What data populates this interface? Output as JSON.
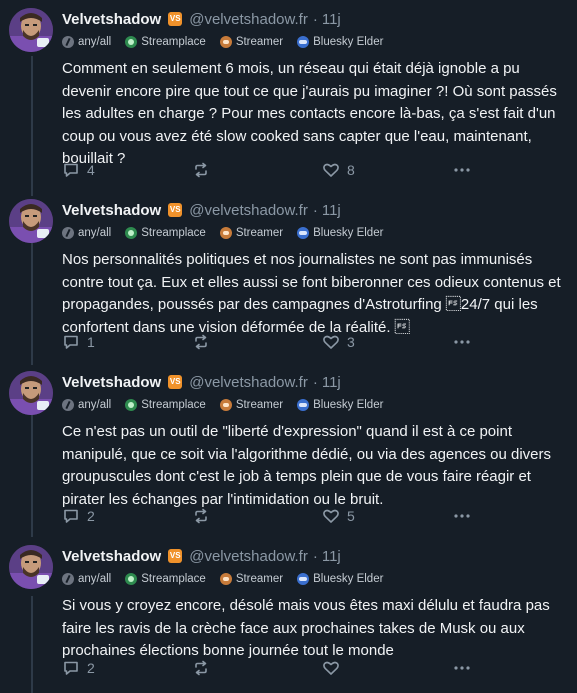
{
  "author": {
    "name": "Velvetshadow",
    "badge_label": "VS",
    "handle": "@velvetshadow.fr",
    "separator": "·",
    "time": "11j"
  },
  "badges": [
    {
      "icon": "any-icon",
      "label": "any/all"
    },
    {
      "icon": "streamplace-icon",
      "label": "Streamplace"
    },
    {
      "icon": "streamer-icon",
      "label": "Streamer"
    },
    {
      "icon": "bluesky-elder-icon",
      "label": "Bluesky Elder"
    }
  ],
  "posts": [
    {
      "text": "Comment en seulement 6 mois, un réseau qui était déjà ignoble a pu devenir encore pire que tout ce que j'aurais pu imaginer ?! Où sont passés les adultes en charge ? Pour mes contacts encore là-bas, ça s'est fait d'un coup ou vous avez été slow cooked sans capter que l'eau, maintenant, bouillait ?",
      "replies": "4",
      "reposts": "",
      "likes": "8"
    },
    {
      "text": "Nos personnalités politiques et nos journalistes ne sont pas immunisés contre tout ça. Eux et elles aussi se font biberonner ces odieux contenus et propagandes, poussés par des campagnes d'Astroturfing \u001c24/7 qui les confortent dans une vision déformée de la réalité. \u001c",
      "replies": "1",
      "reposts": "",
      "likes": "3"
    },
    {
      "text": "Ce n'est pas un outil de \"liberté d'expression\" quand il est à ce point manipulé, que ce soit via l'algorithme dédié, ou via des agences ou divers groupuscules dont c'est le job à temps plein que de vous faire réagir et pirater les échanges par l'intimidation ou le bruit.",
      "replies": "2",
      "reposts": "",
      "likes": "5"
    },
    {
      "text": "Si vous y croyez encore, désolé mais vous êtes maxi délulu et faudra pas faire les ravis de la crèche face aux prochaines takes de Musk ou aux prochaines élections bonne journée tout le monde",
      "replies": "2",
      "reposts": "",
      "likes": ""
    }
  ],
  "colors": {
    "background": "#161e27",
    "text": "#f1f3f5",
    "muted": "#8b98a5",
    "badge_orange": "#f0922b",
    "thread_line": "#2e3a48"
  }
}
